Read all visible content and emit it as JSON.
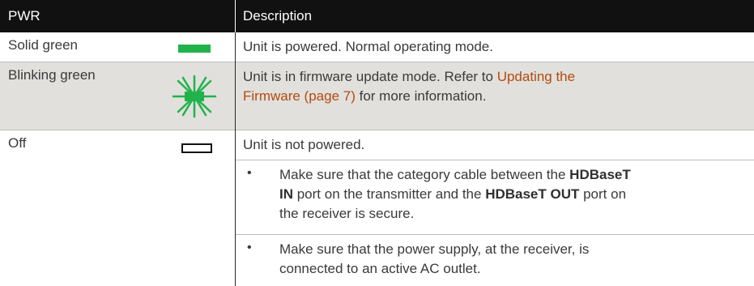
{
  "header": {
    "col1": "PWR",
    "col2": "Description"
  },
  "rows": [
    {
      "pwr": "Solid green",
      "description": "Unit is powered.  Normal operating mode."
    },
    {
      "pwr": "Blinking green",
      "description_prefix": "Unit is in firmware update mode.  Refer to ",
      "link_text_1": "Updating the",
      "link_text_2": "Firmware (page 7)",
      "description_suffix": " for more information."
    },
    {
      "pwr": "Off",
      "description": "Unit is not powered.",
      "bullets": [
        {
          "dot": "•",
          "p1": "Make sure that the category cable between the ",
          "b1": "HDBaseT",
          "b2": "IN",
          "p2": " port on the transmitter and the ",
          "b3": "HDBaseT OUT",
          "p3": " port on",
          "p4": "the receiver is secure."
        },
        {
          "dot": "•",
          "line1": "Make sure that the power supply, at the receiver, is",
          "line2": "connected to an active AC outlet."
        }
      ]
    }
  ],
  "colors": {
    "header_bg": "#111111",
    "shade_bg": "#e1e0dc",
    "led_green": "#22b24c",
    "link": "#b44a11"
  },
  "icons": {
    "solid": "led-solid-green-icon",
    "blinking": "led-blinking-green-icon",
    "off": "led-off-icon"
  }
}
